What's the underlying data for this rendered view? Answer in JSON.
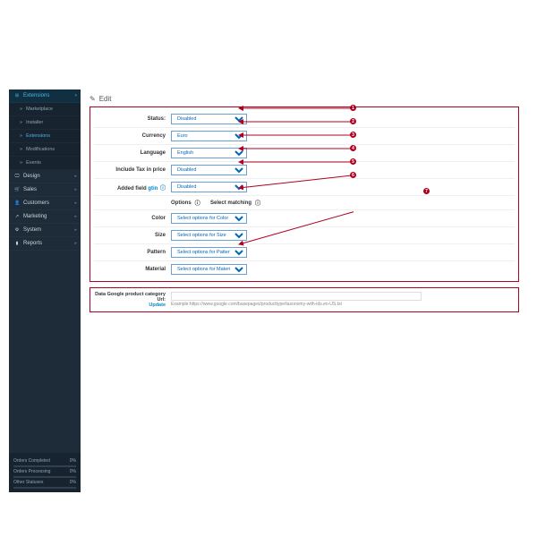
{
  "nav": {
    "extensions": "Extensions",
    "sub": {
      "marketplace": "Marketplace",
      "installer": "Installer",
      "extensions2": "Extensions",
      "modifications": "Modifications",
      "events": "Events"
    },
    "design": "Design",
    "sales": "Sales",
    "customers": "Customers",
    "marketing": "Marketing",
    "system": "System",
    "reports": "Reports"
  },
  "stats": {
    "completed_l": "Orders Completed",
    "completed_v": "0%",
    "processing_l": "Orders Processing",
    "processing_v": "0%",
    "other_l": "Other Statuses",
    "other_v": "0%"
  },
  "page": {
    "edit": "Edit"
  },
  "labels": {
    "status": "Status:",
    "currency": "Currency",
    "language": "Language",
    "tax": "Include Tax in price",
    "addedfield": "Added field",
    "gtin": "gtin",
    "options": "Options",
    "selectmatch": "Select matching",
    "color": "Color",
    "size": "Size",
    "pattern": "Pattern",
    "material": "Material"
  },
  "values": {
    "status": "Disabled",
    "currency": "Euro",
    "language": "English",
    "tax": "Disabled",
    "addedfield": "Disabled",
    "color": "Select options for Color",
    "size": "Select options for Size",
    "pattern": "Select options for Pattern",
    "material": "Select options for Materi"
  },
  "url": {
    "label": "Data Google product category Url:",
    "update": "Update",
    "example": "Example:https://www.google.com/basepages/producttype/taxonomy-with-ids.en-US.txt"
  },
  "callouts": {
    "c1": "1",
    "c2": "2",
    "c3": "3",
    "c4": "4",
    "c5": "5",
    "c6": "6",
    "c7": "7"
  }
}
